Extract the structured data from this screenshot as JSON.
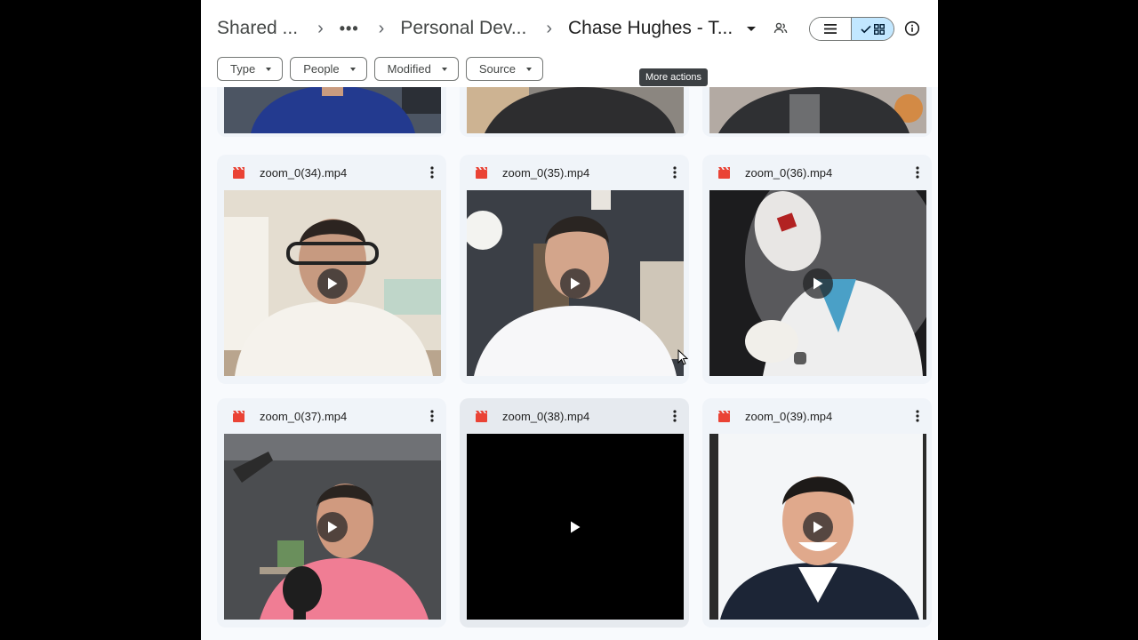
{
  "breadcrumbs": {
    "root": "Shared ...",
    "overflow": "•••",
    "middle": "Personal Dev...",
    "current": "Chase Hughes - T..."
  },
  "tooltip": "More actions",
  "filters": [
    "Type",
    "People",
    "Modified",
    "Source"
  ],
  "icons": {
    "file": "video-file-icon",
    "more": "more-vert-icon",
    "play": "play-icon",
    "list_view": "list-view-icon",
    "grid_view": "grid-view-icon",
    "info": "info-icon",
    "people": "shared-people-icon"
  },
  "colors": {
    "accent": "#c2e7ff",
    "file_icon": "#ea4335",
    "card": "#f0f4f9"
  },
  "files": [
    {
      "name": "zoom_0(34).mp4"
    },
    {
      "name": "zoom_0(35).mp4"
    },
    {
      "name": "zoom_0(36).mp4"
    },
    {
      "name": "zoom_0(37).mp4"
    },
    {
      "name": "zoom_0(38).mp4"
    },
    {
      "name": "zoom_0(39).mp4"
    }
  ]
}
